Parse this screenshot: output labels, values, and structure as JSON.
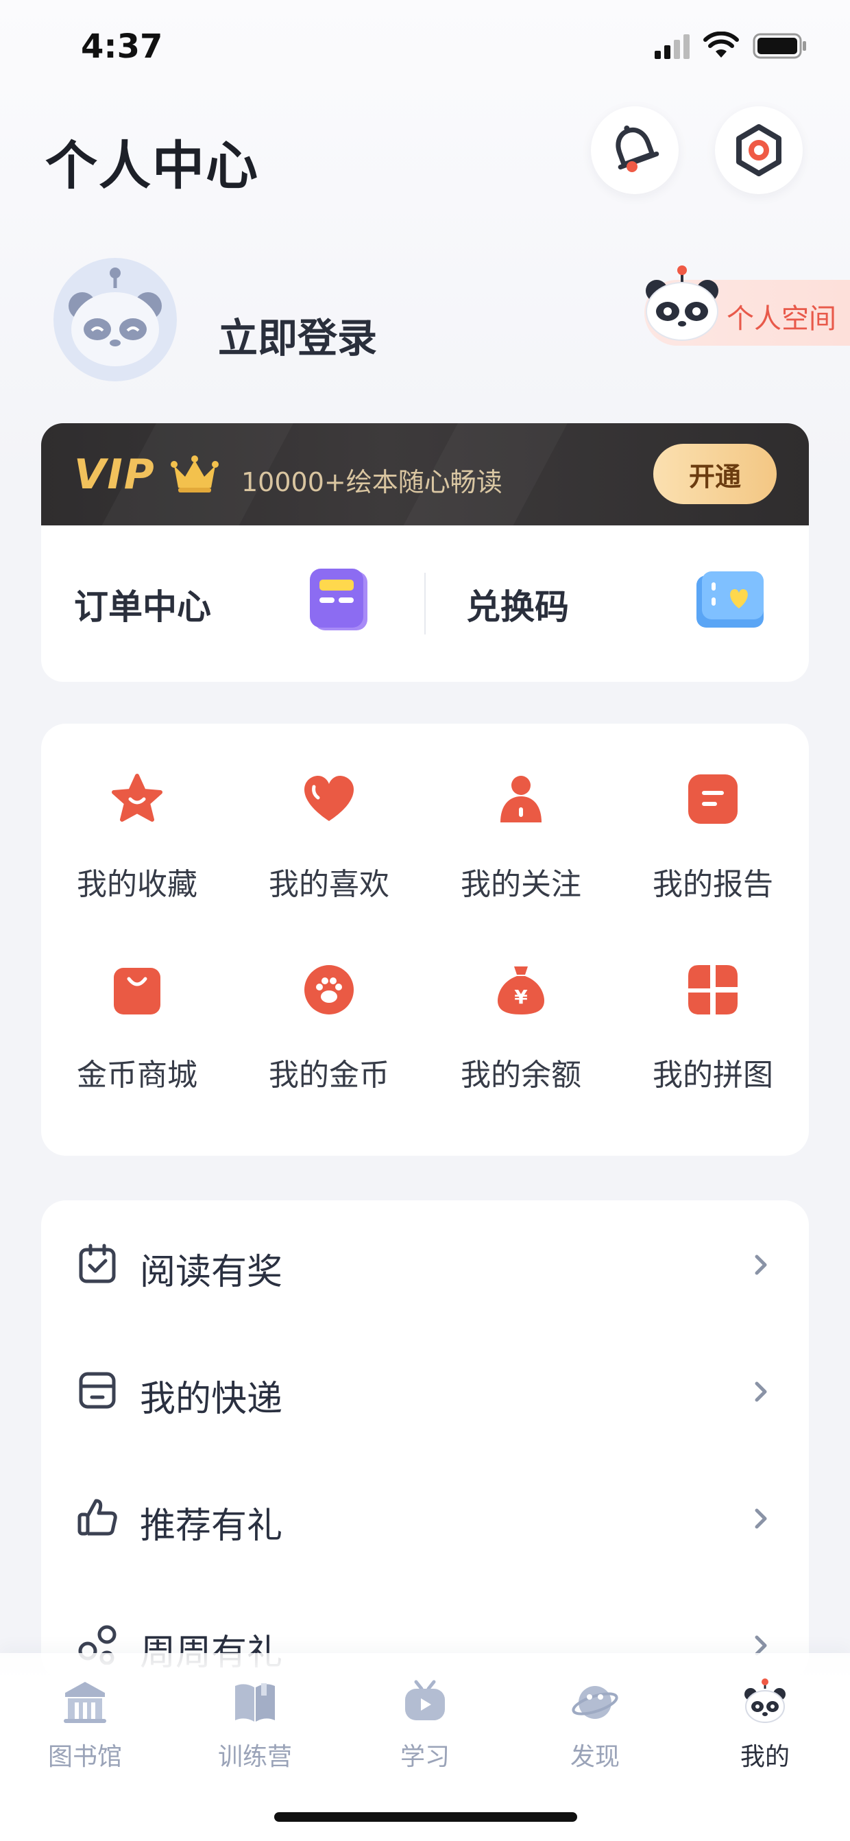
{
  "status_bar": {
    "time": "4:37"
  },
  "header": {
    "title": "个人中心"
  },
  "profile": {
    "login_label": "立即登录",
    "space_label": "个人空间"
  },
  "vip": {
    "logo": "VIP",
    "slogan": "10000+绘本随心畅读",
    "open_button": "开通"
  },
  "shortcuts": {
    "order_center": "订单中心",
    "redeem_code": "兑换码"
  },
  "grid": {
    "items": [
      {
        "label": "我的收藏",
        "icon": "star-icon"
      },
      {
        "label": "我的喜欢",
        "icon": "heart-icon"
      },
      {
        "label": "我的关注",
        "icon": "person-icon"
      },
      {
        "label": "我的报告",
        "icon": "report-icon"
      },
      {
        "label": "金币商城",
        "icon": "shopping-bag-icon"
      },
      {
        "label": "我的金币",
        "icon": "paw-coin-icon"
      },
      {
        "label": "我的余额",
        "icon": "money-bag-icon"
      },
      {
        "label": "我的拼图",
        "icon": "puzzle-icon"
      }
    ],
    "accent_color": "#ea5a44"
  },
  "menu": {
    "items": [
      {
        "label": "阅读有奖",
        "icon": "calendar-check-icon"
      },
      {
        "label": "我的快递",
        "icon": "package-icon"
      },
      {
        "label": "推荐有礼",
        "icon": "thumbs-up-icon"
      },
      {
        "label": "周周有礼",
        "icon": "share-icon"
      }
    ]
  },
  "tab_bar": {
    "items": [
      {
        "label": "图书馆",
        "icon": "library-icon",
        "active": false
      },
      {
        "label": "训练营",
        "icon": "book-icon",
        "active": false
      },
      {
        "label": "学习",
        "icon": "tv-icon",
        "active": false
      },
      {
        "label": "发现",
        "icon": "planet-icon",
        "active": false
      },
      {
        "label": "我的",
        "icon": "panda-icon",
        "active": true
      }
    ],
    "active_color": "#2a2f3c",
    "inactive_color": "#9aa3b8"
  }
}
